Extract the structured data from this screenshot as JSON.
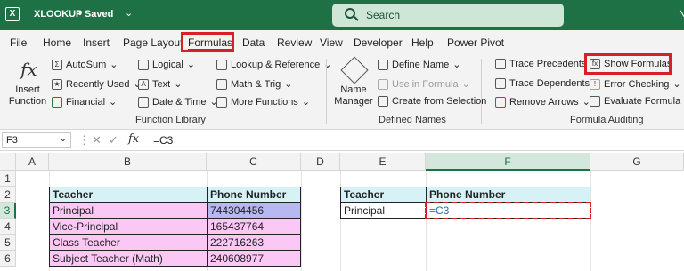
{
  "titlebar": {
    "app_icon": "excel-icon",
    "filename": "XLOOKUP",
    "saved": "• Saved",
    "chevron": "⌄",
    "search_placeholder": "Search",
    "user_initial": "N"
  },
  "tabs": [
    "File",
    "Home",
    "Insert",
    "Page Layout",
    "Formulas",
    "Data",
    "Review",
    "View",
    "Developer",
    "Help",
    "Power Pivot"
  ],
  "active_tab": "Formulas",
  "ribbon": {
    "insert_function": {
      "icon": "fx",
      "label_line1": "Insert",
      "label_line2": "Function"
    },
    "function_library": {
      "label": "Function Library",
      "autosum": "AutoSum",
      "recently_used": "Recently Used",
      "financial": "Financial",
      "logical": "Logical",
      "text": "Text",
      "date_time": "Date & Time",
      "lookup_reference": "Lookup & Reference",
      "math_trig": "Math & Trig",
      "more_functions": "More Functions"
    },
    "defined_names": {
      "label": "Defined Names",
      "name_manager_line1": "Name",
      "name_manager_line2": "Manager",
      "define_name": "Define Name",
      "use_in_formula": "Use in Formula",
      "create_from_selection": "Create from Selection"
    },
    "formula_auditing": {
      "label": "Formula Auditing",
      "trace_precedents": "Trace Precedents",
      "trace_dependents": "Trace Dependents",
      "remove_arrows": "Remove Arrows",
      "show_formulas": "Show Formulas",
      "error_checking": "Error Checking",
      "evaluate_formula": "Evaluate Formula"
    }
  },
  "formula_bar": {
    "name_box": "F3",
    "formula": "=C3"
  },
  "columns": [
    "A",
    "B",
    "C",
    "D",
    "E",
    "F",
    "G"
  ],
  "rows": [
    "1",
    "2",
    "3",
    "4",
    "5",
    "6"
  ],
  "table1": {
    "headers": [
      "Teacher",
      "Phone Number"
    ],
    "rows": [
      [
        "Principal",
        "744304456"
      ],
      [
        "Vice-Principal",
        "165437764"
      ],
      [
        "Class Teacher",
        "222716263"
      ],
      [
        "Subject Teacher (Math)",
        "240608977"
      ]
    ]
  },
  "table2": {
    "headers": [
      "Teacher",
      "Phone Number"
    ],
    "rows": [
      [
        "Principal",
        "=C3"
      ]
    ]
  },
  "colors": {
    "excel_green": "#1e7145",
    "highlight_red": "#d8202a",
    "header_cyan": "#d6f2f6",
    "row_pink": "#fbc8f6"
  }
}
